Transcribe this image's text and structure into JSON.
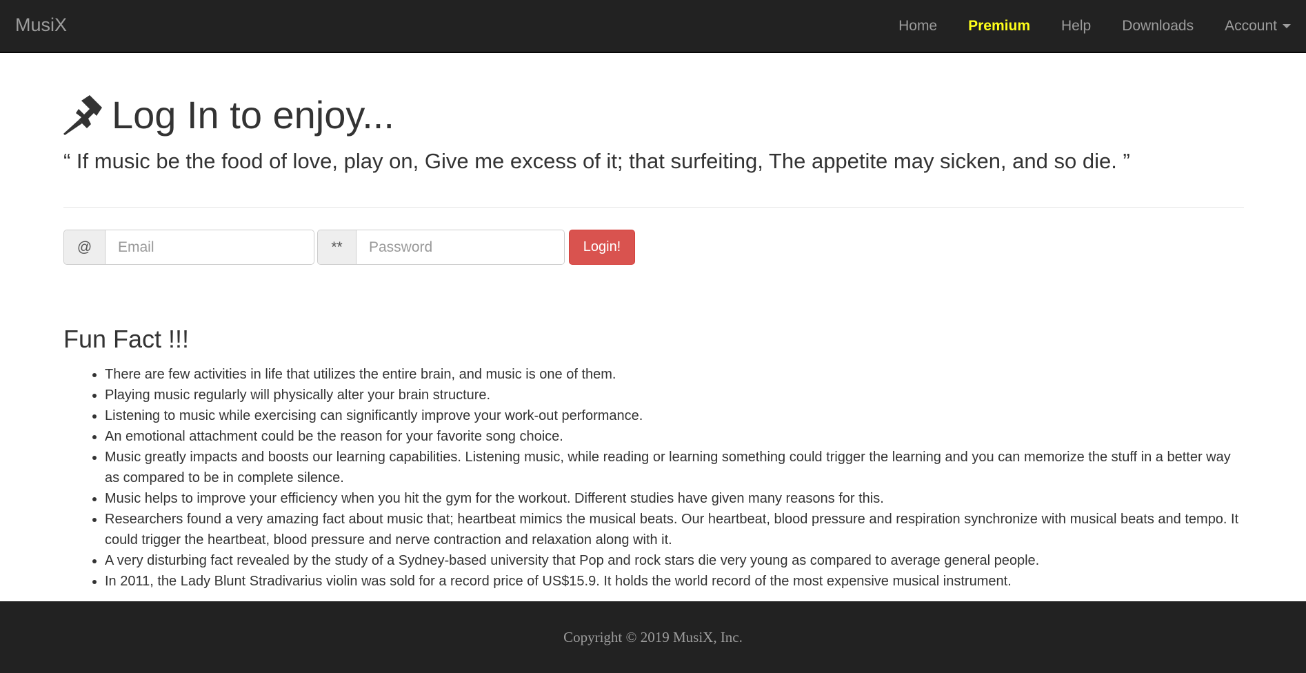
{
  "navbar": {
    "brand": "MusiX",
    "links": [
      {
        "label": "Home"
      },
      {
        "label": "Premium"
      },
      {
        "label": "Help"
      },
      {
        "label": "Downloads"
      },
      {
        "label": "Account"
      }
    ],
    "active_color": "#ffff1a"
  },
  "header": {
    "title": "Log In to enjoy...",
    "icon": "pushpin-icon",
    "quote": "“ If music be the food of love, play on, Give me excess of it; that surfeiting, The appetite may sicken, and so die. ”"
  },
  "login_form": {
    "email_addon": "@",
    "email_placeholder": "Email",
    "email_value": "",
    "password_addon": "**",
    "password_placeholder": "Password",
    "password_value": "",
    "submit_label": "Login!",
    "submit_color": "#d9534f"
  },
  "fun_fact": {
    "title": "Fun Fact !!!",
    "items": [
      "There are few activities in life that utilizes the entire brain, and music is one of them.",
      "Playing music regularly will physically alter your brain structure.",
      "Listening to music while exercising can significantly improve your work-out performance.",
      "An emotional attachment could be the reason for your favorite song choice.",
      "Music greatly impacts and boosts our learning capabilities. Listening music, while reading or learning something could trigger the learning and you can memorize the stuff in a better way as compared to be in complete silence.",
      "Music helps to improve your efficiency when you hit the gym for the workout. Different studies have given many reasons for this.",
      "Researchers found a very amazing fact about music that; heartbeat mimics the musical beats. Our heartbeat, blood pressure and respiration synchronize with musical beats and tempo. It could trigger the heartbeat, blood pressure and nerve contraction and relaxation along with it.",
      "A very disturbing fact revealed by the study of a Sydney-based university that Pop and rock stars die very young as compared to average general people.",
      "In 2011, the Lady Blunt Stradivarius violin was sold for a record price of US$15.9. It holds the world record of the most expensive musical instrument."
    ]
  },
  "footer": {
    "copyright": "Copyright © 2019 MusiX, Inc."
  }
}
